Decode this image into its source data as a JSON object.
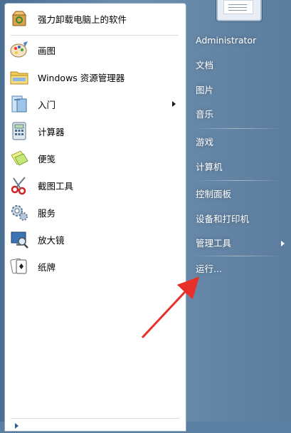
{
  "pinned_programs": [
    {
      "label": "强力卸载电脑上的软件",
      "icon": "uninstall-box-icon"
    },
    {
      "label": "画图",
      "icon": "paint-palette-icon"
    },
    {
      "label": "Windows 资源管理器",
      "icon": "explorer-folder-icon"
    },
    {
      "label": "入门",
      "icon": "getting-started-icon",
      "has_submenu": true
    },
    {
      "label": "计算器",
      "icon": "calculator-icon"
    },
    {
      "label": "便笺",
      "icon": "sticky-notes-icon"
    },
    {
      "label": "截图工具",
      "icon": "snipping-tool-icon"
    },
    {
      "label": "服务",
      "icon": "services-gears-icon"
    },
    {
      "label": "放大镜",
      "icon": "magnifier-icon"
    },
    {
      "label": "纸牌",
      "icon": "solitaire-cards-icon"
    }
  ],
  "right_menu": [
    {
      "label": "Administrator"
    },
    {
      "label": "文档"
    },
    {
      "label": "图片"
    },
    {
      "label": "音乐"
    },
    {
      "label": "游戏"
    },
    {
      "label": "计算机"
    },
    {
      "label": "控制面板"
    },
    {
      "label": "设备和打印机"
    },
    {
      "label": "管理工具",
      "has_submenu": true
    },
    {
      "label": "运行..."
    }
  ],
  "colors": {
    "annotation_arrow": "#e8302a",
    "right_panel": "#5b7c9c",
    "left_panel": "#ffffff"
  }
}
